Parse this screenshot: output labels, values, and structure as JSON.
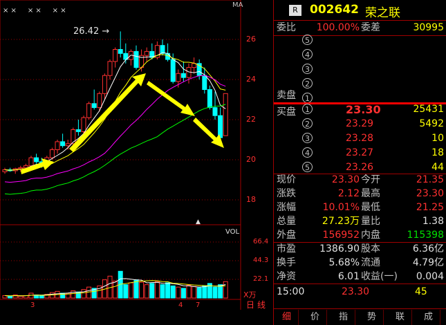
{
  "stock": {
    "badge": "R",
    "code": "002642",
    "name": "荣之联"
  },
  "chart": {
    "top_label": "MA",
    "high_note": "26.42",
    "arrow_glyph": "→",
    "ticks": [
      "26",
      "24",
      "22",
      "20",
      "18"
    ],
    "vol_label": "VOL",
    "vol_ticks": [
      "66.4",
      "44.3",
      "22.1"
    ],
    "vol_unit": "X万",
    "date_marks": [
      "3",
      "4",
      "7"
    ],
    "corner_tabs": [
      "日",
      "线"
    ],
    "markers": "× ×     × ×     × ×"
  },
  "order_book": {
    "weibi_label": "委比",
    "weibi": "100.00%",
    "weicha_label": "委差",
    "weicha": "30995",
    "sell_label": "卖盘",
    "buy_label": "买盘",
    "sells": [
      {
        "n": "5"
      },
      {
        "n": "4"
      },
      {
        "n": "3"
      },
      {
        "n": "2"
      },
      {
        "n": "1"
      }
    ],
    "buys": [
      {
        "n": "1",
        "price": "23.30",
        "vol": "25431"
      },
      {
        "n": "2",
        "price": "23.29",
        "vol": "5492"
      },
      {
        "n": "3",
        "price": "23.28",
        "vol": "10"
      },
      {
        "n": "4",
        "price": "23.27",
        "vol": "18"
      },
      {
        "n": "5",
        "price": "23.26",
        "vol": "44"
      }
    ]
  },
  "stats": [
    {
      "l1": "现价",
      "v1": "23.30",
      "c1": "red",
      "l2": "今开",
      "v2": "21.35",
      "c2": "red"
    },
    {
      "l1": "涨跌",
      "v1": "2.12",
      "c1": "red",
      "l2": "最高",
      "v2": "23.30",
      "c2": "red"
    },
    {
      "l1": "涨幅",
      "v1": "10.01%",
      "c1": "red",
      "l2": "最低",
      "v2": "21.25",
      "c2": "red"
    },
    {
      "l1": "总量",
      "v1": "27.23万",
      "c1": "yel",
      "l2": "量比",
      "v2": "1.38",
      "c2": "wht"
    },
    {
      "l1": "外盘",
      "v1": "156952",
      "c1": "red",
      "l2": "内盘",
      "v2": "115398",
      "c2": "grn"
    },
    {
      "l1": "市盈",
      "v1": "1386.90",
      "c1": "wht",
      "l2": "股本",
      "v2": "6.36亿",
      "c2": "wht"
    },
    {
      "l1": "换手",
      "v1": "5.68%",
      "c1": "wht",
      "l2": "流通",
      "v2": "4.79亿",
      "c2": "wht"
    },
    {
      "l1": "净资",
      "v1": "6.01",
      "c1": "wht",
      "l2": "收益(一)",
      "v2": "0.004",
      "c2": "wht"
    }
  ],
  "tick": {
    "time": "15:00",
    "price": "23.30",
    "vol": "45"
  },
  "tabs": [
    "细",
    "价",
    "指",
    "势",
    "联",
    "成"
  ],
  "colors": {
    "up": "#ff3030",
    "down": "#00ffff",
    "ma1": "#ffffff",
    "ma2": "#ffff00",
    "ma3": "#ff00ff",
    "ma4": "#00ff00",
    "frame": "#a00000"
  }
}
